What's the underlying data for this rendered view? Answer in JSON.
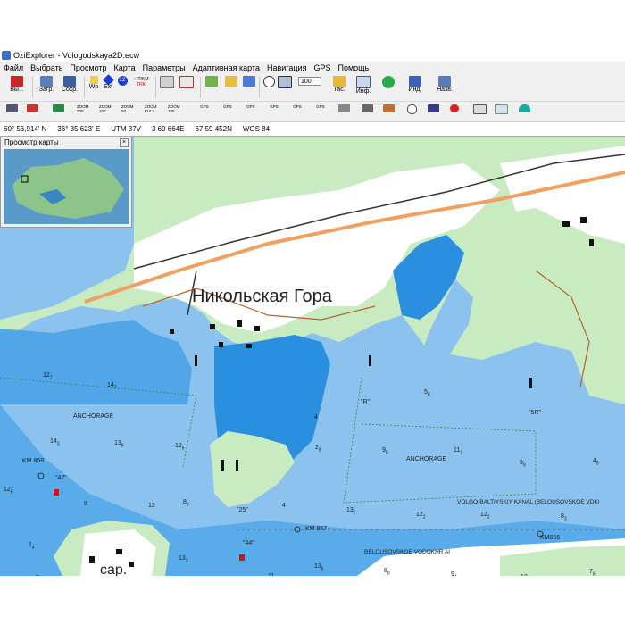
{
  "window": {
    "title": "OziExplorer - Vologodskaya2D.ecw"
  },
  "menu": [
    "Файл",
    "Выбрать",
    "Просмотр",
    "Карта",
    "Параметры",
    "Адаптивная карта",
    "Навигация",
    "GPS",
    "Помощь"
  ],
  "toolbar1": {
    "exit_label": "Вы...",
    "load_label": "Загр.",
    "save_label": "Сохр.",
    "wp_label": "Wp",
    "ext_label": "Ext",
    "zoom_value": "100",
    "tas_label": "Тас.",
    "info_label": "Инф.",
    "ind_label": "Инд.",
    "nav_label": "Назв.",
    "track_count": "12",
    "track_label1": "+TRKM",
    "track_label2": "TRK"
  },
  "toolbar2": {
    "zoom_buttons": [
      "ZOOM 200",
      "ZOOM 100",
      "ZOOM 50",
      "ZOOM FULL",
      "ZOOM 100"
    ],
    "gps_buttons": [
      "GPS",
      "GPS",
      "GPS",
      "GPS",
      "GPS",
      "GPS"
    ]
  },
  "statusbar": {
    "lat": "60° 56,914' N",
    "lon": "36° 35,623' E",
    "utm": "UTM  37V",
    "easting": "3 69 664E",
    "northing": "67 59 452N",
    "datum": "WGS 84"
  },
  "overview": {
    "title": "Просмотр карты"
  },
  "map": {
    "town_label": "Никольская Гора",
    "island_label": "сар.",
    "anchorage1": "ANCHORAGE",
    "anchorage2": "ANCHORAGE",
    "km868": "KM 868",
    "km867": "KM 867",
    "km866": "KM866",
    "canal": "VOLGO-BALTIYSKIY KANAL (BELOUSOVSKOE VDKI",
    "reservoir": "BELOUSOVSKOE VODOKHR AI",
    "buoy_r": "\"R\"",
    "buoy_5r": "\"5R\"",
    "buoy_42": "\"42\"",
    "buoy_25": "\"25\"",
    "buoy_44": "\"44\"",
    "depths": [
      {
        "v": "12",
        "s": "7"
      },
      {
        "v": "14",
        "s": "7"
      },
      {
        "v": "14",
        "s": "3"
      },
      {
        "v": "13",
        "s": "8"
      },
      {
        "v": "12",
        "s": "6"
      },
      {
        "v": "12",
        "s": "6"
      },
      {
        "v": "8",
        "s": ""
      },
      {
        "v": "13",
        "s": ""
      },
      {
        "v": "8",
        "s": "9"
      },
      {
        "v": "4",
        "s": ""
      },
      {
        "v": "4",
        "s": ""
      },
      {
        "v": "2",
        "s": "8"
      },
      {
        "v": "5",
        "s": "8"
      },
      {
        "v": "9",
        "s": "8"
      },
      {
        "v": "11",
        "s": "2"
      },
      {
        "v": "9",
        "s": "9"
      },
      {
        "v": "4",
        "s": "5"
      },
      {
        "v": "13",
        "s": "2"
      },
      {
        "v": "12",
        "s": "2"
      },
      {
        "v": "12",
        "s": "2"
      },
      {
        "v": "8",
        "s": "3"
      },
      {
        "v": "1",
        "s": "4"
      },
      {
        "v": "5",
        "s": "8"
      },
      {
        "v": "13",
        "s": "3"
      },
      {
        "v": "11",
        "s": ""
      },
      {
        "v": "13",
        "s": "5"
      },
      {
        "v": "8",
        "s": "8"
      },
      {
        "v": "9",
        "s": "4"
      },
      {
        "v": "12",
        "s": "3"
      },
      {
        "v": "7",
        "s": "6"
      },
      {
        "v": "8",
        "s": "5"
      },
      {
        "v": "9",
        "s": "3"
      }
    ],
    "colors": {
      "deep_water": "#8cc3ee",
      "shallow_water": "#2b8fe0",
      "land_white": "#ffffff",
      "land_green": "#c9ebc2",
      "road_orange": "#f0a060",
      "contour_brown": "#b8632c"
    }
  }
}
